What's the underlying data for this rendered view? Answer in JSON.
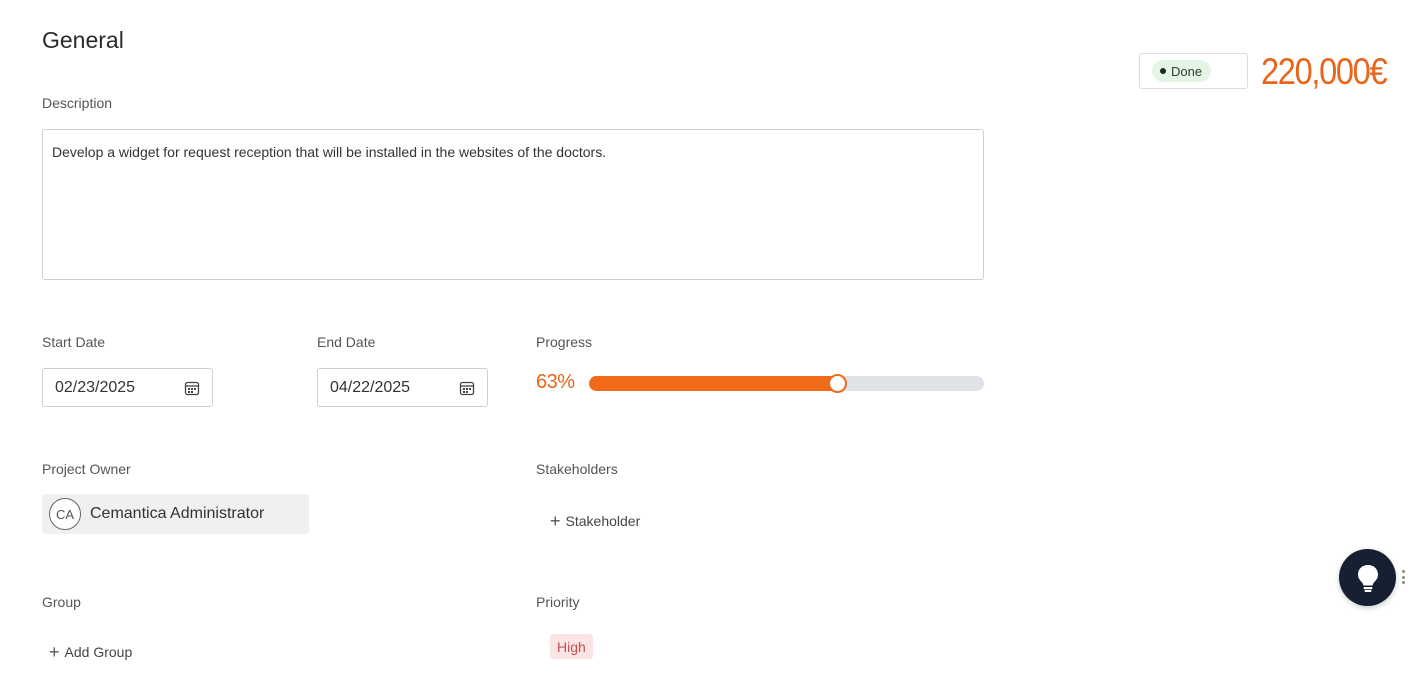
{
  "section": {
    "title": "General"
  },
  "description": {
    "label": "Description",
    "value": "Develop a widget for request reception that will be installed in the websites of the doctors."
  },
  "start_date": {
    "label": "Start Date",
    "value": "02/23/2025"
  },
  "end_date": {
    "label": "End Date",
    "value": "04/22/2025"
  },
  "progress": {
    "label": "Progress",
    "value_text": "63%",
    "value": 63
  },
  "project_owner": {
    "label": "Project Owner",
    "initials": "CA",
    "name": "Cemantica Administrator"
  },
  "stakeholders": {
    "label": "Stakeholders",
    "add_label": "Stakeholder"
  },
  "group": {
    "label": "Group",
    "add_label": "Add Group"
  },
  "priority": {
    "label": "Priority",
    "value": "High"
  },
  "status": {
    "value": "Done"
  },
  "budget": {
    "value": "220,000€"
  },
  "icons": {
    "calendar": "calendar-icon",
    "plus": "plus-icon",
    "lightbulb": "lightbulb-icon"
  },
  "colors": {
    "accent": "#f06a1a",
    "progress_track": "#dfe2e6",
    "status_bg": "#e4f5e6",
    "priority_bg": "#fbe4e4",
    "priority_text": "#c45050",
    "fab_bg": "#172033"
  }
}
